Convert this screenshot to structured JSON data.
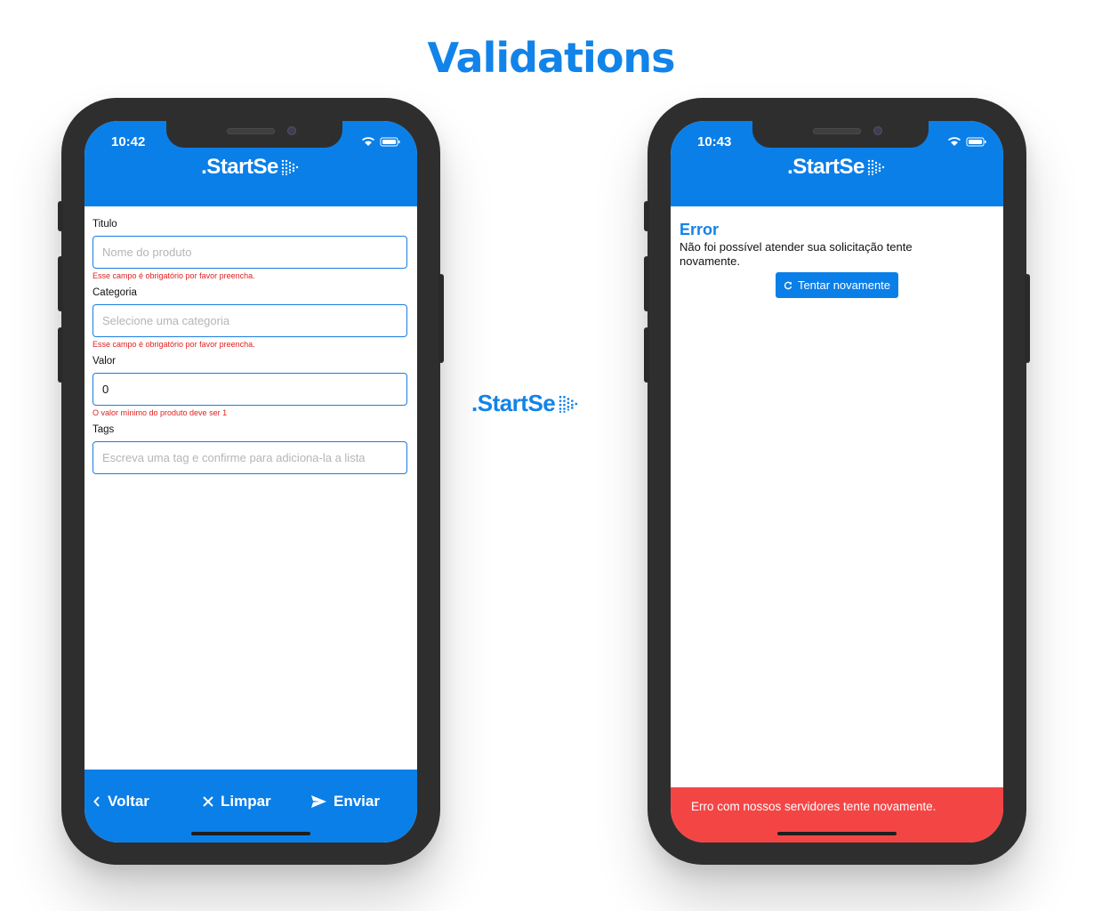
{
  "page": {
    "title": "Validations"
  },
  "center_logo": ".StartSe",
  "left_phone": {
    "time": "10:42",
    "logo": ".StartSe",
    "form": {
      "titulo": {
        "label": "Titulo",
        "placeholder": "Nome do produto",
        "error": "Esse campo é obrigatório por favor preencha."
      },
      "categoria": {
        "label": "Categoria",
        "placeholder": "Selecione uma categoria",
        "error": "Esse campo é obrigatório por favor preencha."
      },
      "valor": {
        "label": "Valor",
        "value": "0",
        "error": "O valor mínimo do produto deve ser 1"
      },
      "tags": {
        "label": "Tags",
        "placeholder": "Escreva uma tag e confirme para adiciona-la a lista"
      }
    },
    "bottom_bar": {
      "back_label": "Voltar",
      "clear_label": "Limpar",
      "send_label": "Enviar"
    }
  },
  "right_phone": {
    "time": "10:43",
    "logo": ".StartSe",
    "error": {
      "title": "Error",
      "message": "Não foi possível atender sua solicitação tente novamente.",
      "retry_label": "Tentar novamente"
    },
    "snackbar": {
      "message": "Erro com nossos servidores tente novamente."
    }
  },
  "colors": {
    "brand_blue": "#0a7fe8",
    "title_blue": "#1283e8",
    "error_red": "#e02020",
    "snackbar_red": "#f44545",
    "phone_frame": "#2e2e2e"
  }
}
